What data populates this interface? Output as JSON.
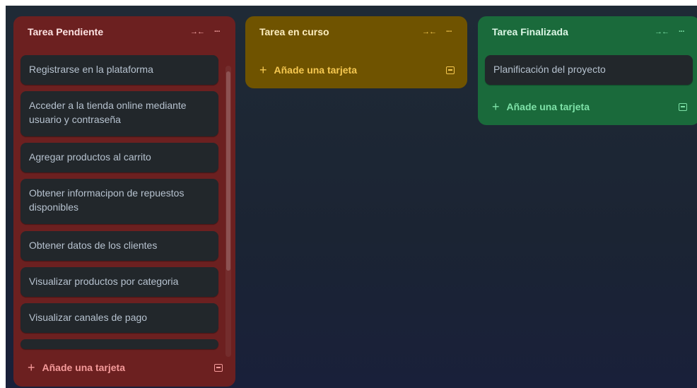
{
  "colors": {
    "board_bg": "#1d2535",
    "pending_list": "#6c2020",
    "in_progress_list": "#6f5300",
    "done_list": "#1a6a3b",
    "card_bg": "#22272b",
    "card_text": "#b6c2cf"
  },
  "lists": [
    {
      "title": "Tarea Pendiente",
      "collapse_icon": "collapse-arrows-icon",
      "menu_icon": "more-horizontal-icon",
      "cards": [
        "Registrarse en la plataforma",
        "Acceder a la tienda online mediante usuario y contraseña",
        "Agregar productos al carrito",
        "Obtener informacipon de repuestos disponibles",
        "Obtener datos de los clientes",
        "Visualizar productos por categoria",
        "Visualizar canales de pago",
        ""
      ],
      "add_card_label": "Añade una tarjeta",
      "template_icon": "card-template-icon"
    },
    {
      "title": "Tarea en curso",
      "collapse_icon": "collapse-arrows-icon",
      "menu_icon": "more-horizontal-icon",
      "cards": [],
      "add_card_label": "Añade una tarjeta",
      "template_icon": "card-template-icon"
    },
    {
      "title": "Tarea Finalizada",
      "collapse_icon": "collapse-arrows-icon",
      "menu_icon": "more-horizontal-icon",
      "cards": [
        "Planificación del proyecto"
      ],
      "add_card_label": "Añade una tarjeta",
      "template_icon": "card-template-icon"
    }
  ],
  "icons": {
    "collapse": "→←",
    "menu": "···",
    "plus": "+"
  }
}
